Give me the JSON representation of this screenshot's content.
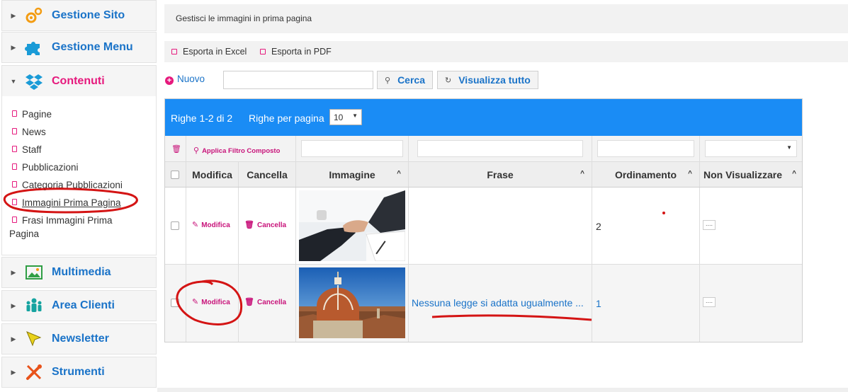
{
  "sidebar": {
    "panels": [
      {
        "label": "Gestione Sito",
        "icon": "gears-icon"
      },
      {
        "label": "Gestione Menu",
        "icon": "puzzle-icon"
      },
      {
        "label": "Contenuti",
        "icon": "dropbox-icon"
      },
      {
        "label": "Multimedia",
        "icon": "image-icon"
      },
      {
        "label": "Area Clienti",
        "icon": "users-icon"
      },
      {
        "label": "Newsletter",
        "icon": "cursor-icon"
      },
      {
        "label": "Strumenti",
        "icon": "tools-icon"
      }
    ],
    "contenuti_items": [
      "Pagine",
      "News",
      "Staff",
      "Pubblicazioni",
      "Categoria Pubblicazioni",
      "Immagini Prima Pagina",
      "Frasi Immagini Prima",
      "Pagina"
    ]
  },
  "main": {
    "title": "Gestisci le immagini in prima pagina",
    "export_excel": "Esporta in Excel",
    "export_pdf": "Esporta in PDF",
    "nuovo": "Nuovo",
    "search_value": "",
    "cerca": "Cerca",
    "visualizza_tutto": "Visualizza tutto"
  },
  "grid": {
    "rows_info": "Righe 1-2 di 2",
    "rows_per_page_label": "Righe per pagina",
    "rows_per_page_value": "10",
    "filtro_composto": "Applica Filtro Composto",
    "columns": [
      "Modifica",
      "Cancella",
      "Immagine",
      "Frase",
      "Ordinamento",
      "Non Visualizzare"
    ],
    "rows": [
      {
        "modifica": "Modifica",
        "cancella": "Cancella",
        "image": "handshake-photo",
        "frase": "",
        "ordinamento": "2",
        "non_visualizzare": "...."
      },
      {
        "modifica": "Modifica",
        "cancella": "Cancella",
        "image": "florence-duomo-photo",
        "frase": "Nessuna legge si adatta ugualmente ...",
        "ordinamento": "1",
        "non_visualizzare": "...."
      }
    ]
  },
  "colors": {
    "accent_blue": "#1a73c8",
    "accent_pink": "#e6197d",
    "grid_header": "#1a8cf5",
    "annotation_red": "#d41414"
  }
}
